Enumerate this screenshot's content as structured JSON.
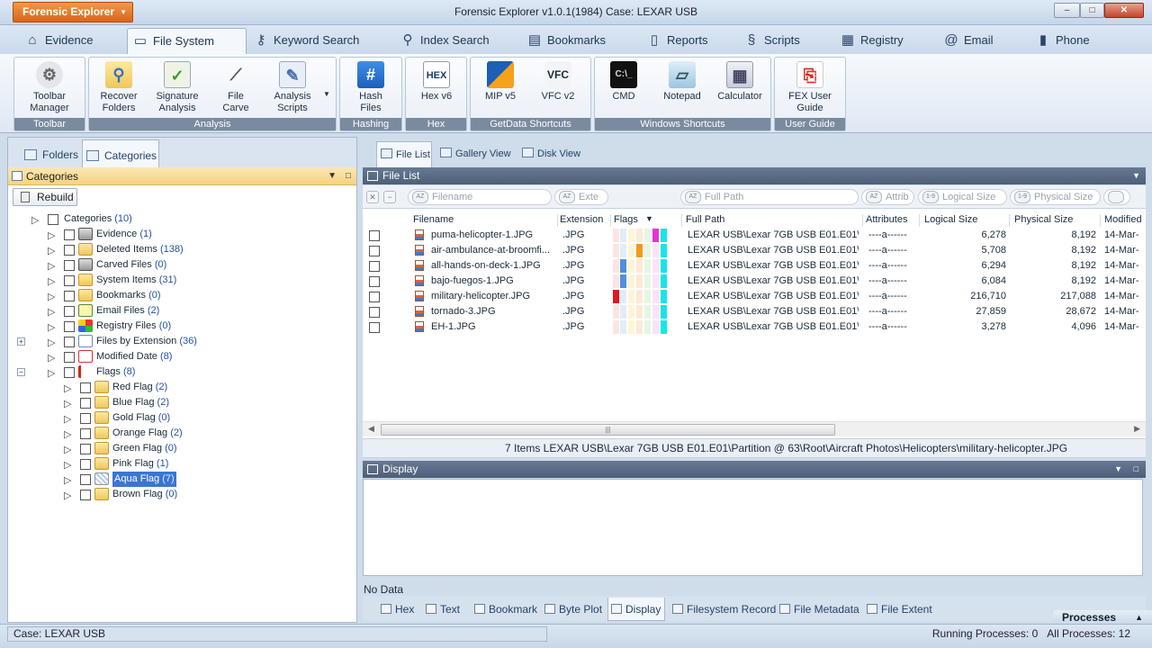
{
  "app": {
    "menu_label": "Forensic Explorer",
    "window_title": "Forensic Explorer v1.0.1(1984)  Case: LEXAR USB",
    "min_glyph": "–",
    "max_glyph": "□",
    "close_glyph": "✕"
  },
  "ribbon_tabs": [
    "Evidence",
    "File System",
    "Keyword Search",
    "Index Search",
    "Bookmarks",
    "Reports",
    "Scripts",
    "Registry",
    "Email",
    "Phone"
  ],
  "ribbon_tab_icons": [
    "home-icon",
    "folder-icon",
    "key-icon",
    "magnifier-icon",
    "bookmarks-icon",
    "report-icon",
    "scripts-icon",
    "registry-icon",
    "email-icon",
    "phone-icon"
  ],
  "ribbon_groups": {
    "toolbar": "Toolbar",
    "analysis": "Analysis",
    "hashing": "Hashing",
    "hex": "Hex",
    "getdata": "GetData Shortcuts",
    "windows": "Windows Shortcuts",
    "userguide": "User Guide"
  },
  "ribbon_buttons": {
    "toolbar_manager": "Toolbar\nManager",
    "recover_folders": "Recover\nFolders",
    "signature_analysis": "Signature\nAnalysis",
    "file_carve": "File\nCarve",
    "analysis_scripts": "Analysis\nScripts",
    "hash_files": "Hash\nFiles",
    "hex_v6": "Hex v6",
    "mip_v5": "MIP v5",
    "vfc_v2": "VFC v2",
    "cmd": "CMD",
    "notepad": "Notepad",
    "calculator": "Calculator",
    "fex_user_guide": "FEX User\nGuide",
    "hash_glyph": "#",
    "hex_logo": "HEX"
  },
  "left": {
    "tab_folders": "Folders",
    "tab_categories": "Categories",
    "header": "Categories",
    "rebuild": "Rebuild"
  },
  "tree": [
    {
      "label": "Categories",
      "count": "(10)"
    },
    {
      "label": "Evidence",
      "count": "(1)"
    },
    {
      "label": "Deleted Items",
      "count": "(138)"
    },
    {
      "label": "Carved Files",
      "count": "(0)"
    },
    {
      "label": "System Items",
      "count": "(31)"
    },
    {
      "label": "Bookmarks",
      "count": "(0)"
    },
    {
      "label": "Email Files",
      "count": "(2)"
    },
    {
      "label": "Registry Files",
      "count": "(0)"
    },
    {
      "label": "Files by Extension",
      "count": "(36)"
    },
    {
      "label": "Modified Date",
      "count": "(8)"
    },
    {
      "label": "Flags",
      "count": "(8)"
    },
    {
      "label": "Red Flag",
      "count": "(2)"
    },
    {
      "label": "Blue Flag",
      "count": "(2)"
    },
    {
      "label": "Gold Flag",
      "count": "(0)"
    },
    {
      "label": "Orange Flag",
      "count": "(2)"
    },
    {
      "label": "Green Flag",
      "count": "(0)"
    },
    {
      "label": "Pink Flag",
      "count": "(1)"
    },
    {
      "label": "Aqua Flag",
      "count": "(7)"
    },
    {
      "label": "Brown Flag",
      "count": "(0)"
    }
  ],
  "view_tabs": [
    "File List",
    "Gallery View",
    "Disk View"
  ],
  "filelist": {
    "header": "File List",
    "filters": [
      "Filename",
      "Exte",
      "Full Path",
      "Attrib",
      "Logical Size",
      "Physical Size"
    ],
    "columns": [
      "Filename",
      "Extension",
      "Flags",
      "Full Path",
      "Attributes",
      "Logical Size",
      "Physical Size",
      "Modified"
    ],
    "rows": [
      {
        "name": "puma-helicopter-1.JPG",
        "ext": ".JPG",
        "path": "LEXAR USB\\Lexar 7GB USB E01.E01\\...",
        "attr": "----a------",
        "lsize": "6,278",
        "psize": "8,192",
        "mod": "14-Mar-"
      },
      {
        "name": "air-ambulance-at-broomfi...",
        "ext": ".JPG",
        "path": "LEXAR USB\\Lexar 7GB USB E01.E01\\...",
        "attr": "----a------",
        "lsize": "5,708",
        "psize": "8,192",
        "mod": "14-Mar-"
      },
      {
        "name": "all-hands-on-deck-1.JPG",
        "ext": ".JPG",
        "path": "LEXAR USB\\Lexar 7GB USB E01.E01\\...",
        "attr": "----a------",
        "lsize": "6,294",
        "psize": "8,192",
        "mod": "14-Mar-"
      },
      {
        "name": "bajo-fuegos-1.JPG",
        "ext": ".JPG",
        "path": "LEXAR USB\\Lexar 7GB USB E01.E01\\...",
        "attr": "----a------",
        "lsize": "6,084",
        "psize": "8,192",
        "mod": "14-Mar-"
      },
      {
        "name": "military-helicopter.JPG",
        "ext": ".JPG",
        "path": "LEXAR USB\\Lexar 7GB USB E01.E01\\...",
        "attr": "----a------",
        "lsize": "216,710",
        "psize": "217,088",
        "mod": "14-Mar-"
      },
      {
        "name": "tornado-3.JPG",
        "ext": ".JPG",
        "path": "LEXAR USB\\Lexar 7GB USB E01.E01\\...",
        "attr": "----a------",
        "lsize": "27,859",
        "psize": "28,672",
        "mod": "14-Mar-"
      },
      {
        "name": "EH-1.JPG",
        "ext": ".JPG",
        "path": "LEXAR USB\\Lexar 7GB USB E01.E01\\...",
        "attr": "----a------",
        "lsize": "3,278",
        "psize": "4,096",
        "mod": "14-Mar-"
      }
    ],
    "flag_colors": {
      "red": "#e4161f",
      "blue": "#4f8fdc",
      "orange": "#f29a1b",
      "pink": "#e831d3",
      "aqua": "#18e4ea"
    },
    "path_status": "7 Items  LEXAR USB\\Lexar 7GB USB E01.E01\\Partition @ 63\\Root\\Aircraft Photos\\Helicopters\\military-helicopter.JPG"
  },
  "display": {
    "header": "Display",
    "no_data": "No Data",
    "tabs": [
      "Hex",
      "Text",
      "Bookmark",
      "Byte Plot",
      "Display",
      "Filesystem Record",
      "File Metadata",
      "File Extent"
    ],
    "processes": "Processes"
  },
  "status": {
    "case": "Case: LEXAR USB",
    "running": "Running Processes: 0",
    "all": "All Processes: 12"
  },
  "glyphs": {
    "expand_plus": "+",
    "expand_minus": "−",
    "tree_tri": "▷",
    "pin": "□",
    "dropdown": "▼",
    "sort_desc": "▼",
    "clear_x": "✕",
    "minus": "−",
    "arrow_left": "◀",
    "arrow_right": "▶",
    "grip": "|||",
    "az": "AZ",
    "num": "1-9",
    "chevron_up": "▲"
  }
}
